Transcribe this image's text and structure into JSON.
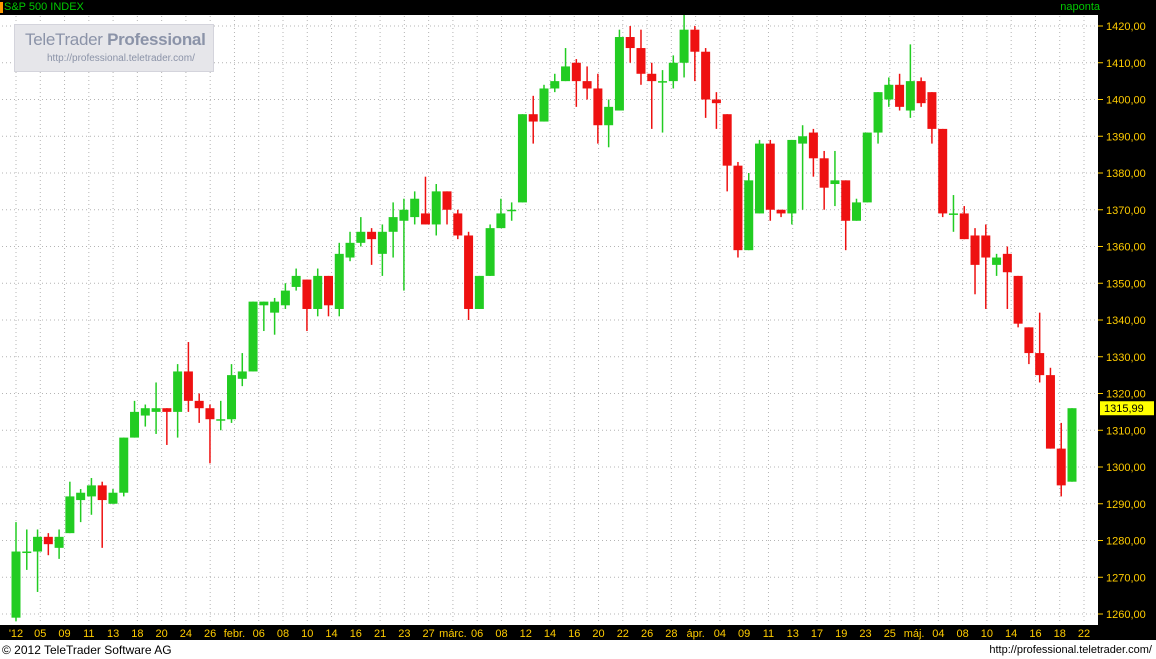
{
  "header": {
    "title": "S&P 500 INDEX",
    "period": "naponta"
  },
  "watermark": {
    "brand_light": "TeleTrader ",
    "brand_bold": "Professional",
    "url": "http://professional.teletrader.com/"
  },
  "footer": {
    "copyright": "© 2012 TeleTrader Software AG",
    "url": "http://professional.teletrader.com/"
  },
  "colors": {
    "up": "#22cc22",
    "down": "#ee1111",
    "axis_bg": "#000000",
    "axis_text": "#ffcc00",
    "last_price_bg": "#ffff00",
    "grid": "#b4b4b4"
  },
  "chart_data": {
    "type": "candlestick",
    "title": "S&P 500 INDEX",
    "ylim": [
      1257,
      1425
    ],
    "y_ticks": [
      "1260,00",
      "1270,00",
      "1280,00",
      "1290,00",
      "1300,00",
      "1310,00",
      "1320,00",
      "1330,00",
      "1340,00",
      "1350,00",
      "1360,00",
      "1370,00",
      "1380,00",
      "1390,00",
      "1400,00",
      "1410,00",
      "1420,00"
    ],
    "last_price": "1315,99",
    "x_tick_labels": [
      "'12",
      "05",
      "09",
      "11",
      "13",
      "18",
      "20",
      "24",
      "26",
      "febr.",
      "06",
      "08",
      "10",
      "14",
      "16",
      "21",
      "23",
      "27",
      "márc.",
      "06",
      "08",
      "12",
      "14",
      "16",
      "20",
      "22",
      "26",
      "28",
      "ápr.",
      "04",
      "09",
      "11",
      "13",
      "17",
      "19",
      "23",
      "25",
      "máj.",
      "04",
      "08",
      "10",
      "14",
      "16",
      "18",
      "22"
    ],
    "candles": [
      {
        "o": 1259,
        "h": 1285,
        "l": 1258,
        "c": 1277
      },
      {
        "o": 1277,
        "h": 1283,
        "l": 1272,
        "c": 1277
      },
      {
        "o": 1277,
        "h": 1283,
        "l": 1266,
        "c": 1281
      },
      {
        "o": 1281,
        "h": 1282,
        "l": 1276,
        "c": 1279
      },
      {
        "o": 1278,
        "h": 1283,
        "l": 1275,
        "c": 1281
      },
      {
        "o": 1282,
        "h": 1296,
        "l": 1282,
        "c": 1292
      },
      {
        "o": 1291,
        "h": 1294,
        "l": 1285,
        "c": 1293
      },
      {
        "o": 1292,
        "h": 1297,
        "l": 1287,
        "c": 1295
      },
      {
        "o": 1295,
        "h": 1296,
        "l": 1278,
        "c": 1291
      },
      {
        "o": 1290,
        "h": 1294,
        "l": 1290,
        "c": 1293
      },
      {
        "o": 1293,
        "h": 1308,
        "l": 1292,
        "c": 1308
      },
      {
        "o": 1308,
        "h": 1318,
        "l": 1308,
        "c": 1315
      },
      {
        "o": 1314,
        "h": 1317,
        "l": 1311,
        "c": 1316
      },
      {
        "o": 1315,
        "h": 1323,
        "l": 1309,
        "c": 1316
      },
      {
        "o": 1316,
        "h": 1316,
        "l": 1306,
        "c": 1315
      },
      {
        "o": 1315,
        "h": 1328,
        "l": 1308,
        "c": 1326
      },
      {
        "o": 1326,
        "h": 1334,
        "l": 1315,
        "c": 1318
      },
      {
        "o": 1318,
        "h": 1320,
        "l": 1312,
        "c": 1316
      },
      {
        "o": 1316,
        "h": 1317,
        "l": 1301,
        "c": 1313
      },
      {
        "o": 1313,
        "h": 1318,
        "l": 1310,
        "c": 1313
      },
      {
        "o": 1313,
        "h": 1328,
        "l": 1312,
        "c": 1325
      },
      {
        "o": 1324,
        "h": 1331,
        "l": 1322,
        "c": 1326
      },
      {
        "o": 1326,
        "h": 1345,
        "l": 1326,
        "c": 1345
      },
      {
        "o": 1344,
        "h": 1345,
        "l": 1337,
        "c": 1345
      },
      {
        "o": 1342,
        "h": 1346,
        "l": 1336,
        "c": 1345
      },
      {
        "o": 1344,
        "h": 1350,
        "l": 1343,
        "c": 1348
      },
      {
        "o": 1349,
        "h": 1354,
        "l": 1348,
        "c": 1352
      },
      {
        "o": 1351,
        "h": 1351,
        "l": 1337,
        "c": 1343
      },
      {
        "o": 1343,
        "h": 1354,
        "l": 1341,
        "c": 1352
      },
      {
        "o": 1352,
        "h": 1352,
        "l": 1341,
        "c": 1344
      },
      {
        "o": 1343,
        "h": 1361,
        "l": 1341,
        "c": 1358
      },
      {
        "o": 1357,
        "h": 1364,
        "l": 1356,
        "c": 1361
      },
      {
        "o": 1361,
        "h": 1368,
        "l": 1360,
        "c": 1364
      },
      {
        "o": 1364,
        "h": 1365,
        "l": 1355,
        "c": 1362
      },
      {
        "o": 1358,
        "h": 1366,
        "l": 1352,
        "c": 1364
      },
      {
        "o": 1364,
        "h": 1372,
        "l": 1357,
        "c": 1368
      },
      {
        "o": 1367,
        "h": 1373,
        "l": 1348,
        "c": 1370
      },
      {
        "o": 1368,
        "h": 1375,
        "l": 1366,
        "c": 1373
      },
      {
        "o": 1369,
        "h": 1379,
        "l": 1366,
        "c": 1366
      },
      {
        "o": 1366,
        "h": 1377,
        "l": 1363,
        "c": 1375
      },
      {
        "o": 1375,
        "h": 1375,
        "l": 1366,
        "c": 1370
      },
      {
        "o": 1369,
        "h": 1370,
        "l": 1362,
        "c": 1363
      },
      {
        "o": 1363,
        "h": 1364,
        "l": 1340,
        "c": 1343
      },
      {
        "o": 1343,
        "h": 1352,
        "l": 1343,
        "c": 1352
      },
      {
        "o": 1352,
        "h": 1366,
        "l": 1352,
        "c": 1365
      },
      {
        "o": 1365,
        "h": 1373,
        "l": 1365,
        "c": 1369
      },
      {
        "o": 1370,
        "h": 1372,
        "l": 1367,
        "c": 1370
      },
      {
        "o": 1372,
        "h": 1396,
        "l": 1372,
        "c": 1396
      },
      {
        "o": 1396,
        "h": 1401,
        "l": 1388,
        "c": 1394
      },
      {
        "o": 1394,
        "h": 1404,
        "l": 1394,
        "c": 1403
      },
      {
        "o": 1403,
        "h": 1407,
        "l": 1402,
        "c": 1405
      },
      {
        "o": 1405,
        "h": 1414,
        "l": 1405,
        "c": 1409
      },
      {
        "o": 1410,
        "h": 1411,
        "l": 1398,
        "c": 1405
      },
      {
        "o": 1405,
        "h": 1409,
        "l": 1400,
        "c": 1403
      },
      {
        "o": 1403,
        "h": 1407,
        "l": 1388,
        "c": 1393
      },
      {
        "o": 1393,
        "h": 1400,
        "l": 1387,
        "c": 1398
      },
      {
        "o": 1397,
        "h": 1419,
        "l": 1397,
        "c": 1417
      },
      {
        "o": 1417,
        "h": 1420,
        "l": 1410,
        "c": 1414
      },
      {
        "o": 1414,
        "h": 1419,
        "l": 1404,
        "c": 1407
      },
      {
        "o": 1407,
        "h": 1410,
        "l": 1392,
        "c": 1405
      },
      {
        "o": 1405,
        "h": 1408,
        "l": 1391,
        "c": 1405
      },
      {
        "o": 1405,
        "h": 1412,
        "l": 1403,
        "c": 1410
      },
      {
        "o": 1410,
        "h": 1423,
        "l": 1406,
        "c": 1419
      },
      {
        "o": 1419,
        "h": 1420,
        "l": 1405,
        "c": 1413
      },
      {
        "o": 1413,
        "h": 1414,
        "l": 1395,
        "c": 1400
      },
      {
        "o": 1400,
        "h": 1402,
        "l": 1392,
        "c": 1399
      },
      {
        "o": 1396,
        "h": 1396,
        "l": 1375,
        "c": 1382
      },
      {
        "o": 1382,
        "h": 1383,
        "l": 1357,
        "c": 1359
      },
      {
        "o": 1359,
        "h": 1380,
        "l": 1359,
        "c": 1378
      },
      {
        "o": 1369,
        "h": 1389,
        "l": 1369,
        "c": 1388
      },
      {
        "o": 1388,
        "h": 1389,
        "l": 1367,
        "c": 1370
      },
      {
        "o": 1370,
        "h": 1370,
        "l": 1368,
        "c": 1369
      },
      {
        "o": 1369,
        "h": 1389,
        "l": 1366,
        "c": 1389
      },
      {
        "o": 1388,
        "h": 1393,
        "l": 1370,
        "c": 1390
      },
      {
        "o": 1391,
        "h": 1392,
        "l": 1379,
        "c": 1384
      },
      {
        "o": 1384,
        "h": 1386,
        "l": 1370,
        "c": 1376
      },
      {
        "o": 1377,
        "h": 1386,
        "l": 1371,
        "c": 1378
      },
      {
        "o": 1378,
        "h": 1378,
        "l": 1359,
        "c": 1367
      },
      {
        "o": 1367,
        "h": 1373,
        "l": 1367,
        "c": 1372
      },
      {
        "o": 1372,
        "h": 1391,
        "l": 1372,
        "c": 1391
      },
      {
        "o": 1391,
        "h": 1402,
        "l": 1388,
        "c": 1402
      },
      {
        "o": 1400,
        "h": 1406,
        "l": 1398,
        "c": 1404
      },
      {
        "o": 1404,
        "h": 1407,
        "l": 1397,
        "c": 1398
      },
      {
        "o": 1397,
        "h": 1415,
        "l": 1395,
        "c": 1405
      },
      {
        "o": 1405,
        "h": 1406,
        "l": 1398,
        "c": 1399
      },
      {
        "o": 1402,
        "h": 1402,
        "l": 1388,
        "c": 1392
      },
      {
        "o": 1392,
        "h": 1392,
        "l": 1368,
        "c": 1369
      },
      {
        "o": 1369,
        "h": 1374,
        "l": 1364,
        "c": 1369
      },
      {
        "o": 1369,
        "h": 1371,
        "l": 1362,
        "c": 1362
      },
      {
        "o": 1363,
        "h": 1365,
        "l": 1347,
        "c": 1355
      },
      {
        "o": 1363,
        "h": 1366,
        "l": 1343,
        "c": 1357
      },
      {
        "o": 1355,
        "h": 1358,
        "l": 1352,
        "c": 1357
      },
      {
        "o": 1358,
        "h": 1360,
        "l": 1343,
        "c": 1353
      },
      {
        "o": 1352,
        "h": 1352,
        "l": 1338,
        "c": 1339
      },
      {
        "o": 1338,
        "h": 1338,
        "l": 1328,
        "c": 1331
      },
      {
        "o": 1331,
        "h": 1342,
        "l": 1323,
        "c": 1325
      },
      {
        "o": 1325,
        "h": 1327,
        "l": 1305,
        "c": 1305
      },
      {
        "o": 1305,
        "h": 1312,
        "l": 1292,
        "c": 1295
      },
      {
        "o": 1296,
        "h": 1316,
        "l": 1296,
        "c": 1316
      }
    ]
  }
}
